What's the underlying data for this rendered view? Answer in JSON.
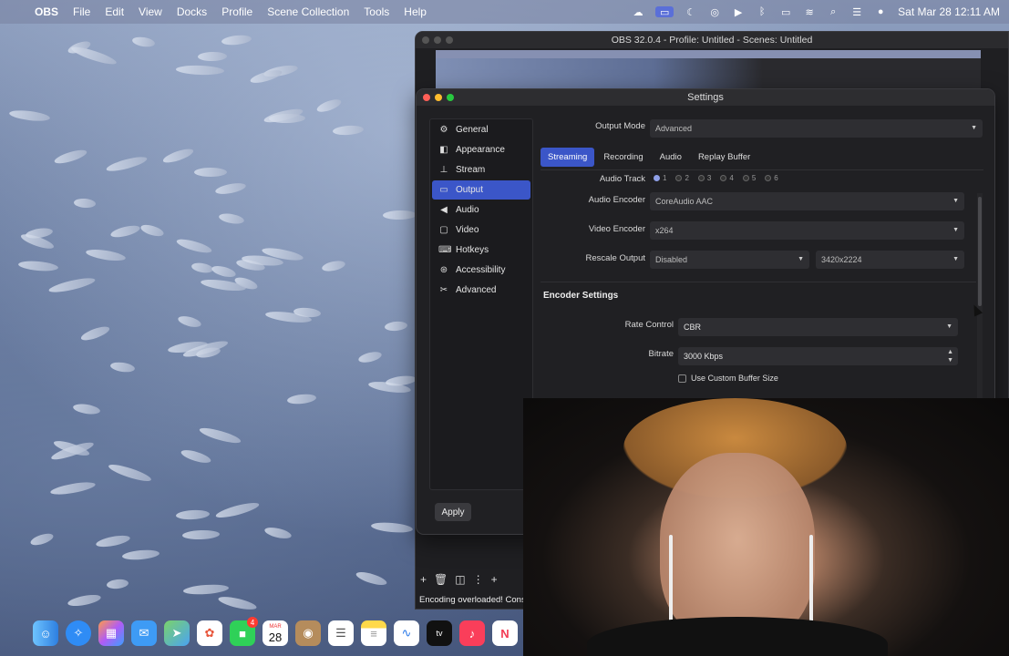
{
  "menubar": {
    "app_name": "OBS",
    "items": [
      "File",
      "Edit",
      "View",
      "Docks",
      "Profile",
      "Scene Collection",
      "Tools",
      "Help"
    ],
    "clock": "Sat Mar 28  12:11 AM",
    "status_icons": [
      "messages-icon",
      "screen-record-icon",
      "moon-icon",
      "ai-icon",
      "play-icon",
      "bluetooth-icon",
      "battery-icon",
      "wifi-icon",
      "search-icon",
      "control-center-icon",
      "siri-icon"
    ]
  },
  "obs_window": {
    "title": "OBS 32.0.4 - Profile: Untitled - Scenes: Untitled",
    "status_text": "Encoding overloaded! Consider",
    "toolbar_icons": [
      "plus-icon",
      "trash-icon",
      "filter-icon",
      "more-icon",
      "plus-icon"
    ]
  },
  "settings": {
    "title": "Settings",
    "apply_label": "Apply",
    "sidebar": [
      {
        "label": "General",
        "icon": "gear-icon",
        "active": false
      },
      {
        "label": "Appearance",
        "icon": "appearance-icon",
        "active": false
      },
      {
        "label": "Stream",
        "icon": "stream-icon",
        "active": false
      },
      {
        "label": "Output",
        "icon": "output-icon",
        "active": true
      },
      {
        "label": "Audio",
        "icon": "speaker-icon",
        "active": false
      },
      {
        "label": "Video",
        "icon": "monitor-icon",
        "active": false
      },
      {
        "label": "Hotkeys",
        "icon": "keyboard-icon",
        "active": false
      },
      {
        "label": "Accessibility",
        "icon": "accessibility-icon",
        "active": false
      },
      {
        "label": "Advanced",
        "icon": "tools-icon",
        "active": false
      }
    ],
    "output_mode_label": "Output Mode",
    "output_mode_value": "Advanced",
    "tabs": [
      "Streaming",
      "Recording",
      "Audio",
      "Replay Buffer"
    ],
    "active_tab": "Streaming",
    "audio_track_label": "Audio Track",
    "audio_tracks": [
      "1",
      "2",
      "3",
      "4",
      "5",
      "6"
    ],
    "audio_encoder_label": "Audio Encoder",
    "audio_encoder_value": "CoreAudio AAC",
    "video_encoder_label": "Video Encoder",
    "video_encoder_value": "x264",
    "rescale_output_label": "Rescale Output",
    "rescale_output_value": "Disabled",
    "rescale_resolution_value": "3420x2224",
    "encoder_settings_title": "Encoder Settings",
    "rate_control_label": "Rate Control",
    "rate_control_value": "CBR",
    "bitrate_label": "Bitrate",
    "bitrate_value": "3000 Kbps",
    "custom_buffer_label": "Use Custom Buffer Size"
  },
  "dock": {
    "apps": [
      "finder-icon",
      "safari-icon",
      "launchpad-icon",
      "mail-icon",
      "maps-icon",
      "photos-icon",
      "facetime-icon",
      "calendar-icon",
      "contacts-icon",
      "reminders-icon",
      "notes-icon",
      "freeform-icon",
      "appletv-icon",
      "music-icon",
      "news-icon"
    ],
    "calendar_month": "MAR",
    "calendar_day": "28",
    "facetime_badge": "4",
    "appletv_label": "tv"
  }
}
